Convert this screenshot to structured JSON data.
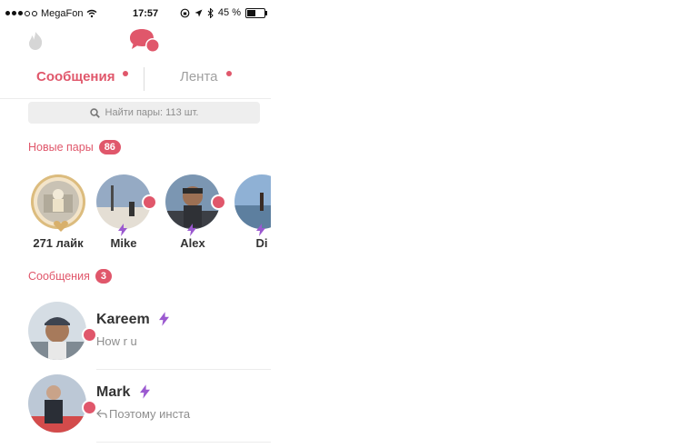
{
  "status_bar": {
    "carrier": "MegaFon",
    "time": "17:57",
    "battery": "45 %"
  },
  "tabs": {
    "messages": "Сообщения",
    "feed": "Лента"
  },
  "search": {
    "placeholder": "Найти пары: 113 шт."
  },
  "new_pairs": {
    "title": "Новые пары",
    "count": "86",
    "items": [
      {
        "label": "271 лайк"
      },
      {
        "label": "Mike"
      },
      {
        "label": "Alex"
      },
      {
        "label": "Di"
      }
    ]
  },
  "messages": {
    "title": "Сообщения",
    "count": "3",
    "items": [
      {
        "name": "Kareem",
        "preview": "How r u"
      },
      {
        "name": "Mark",
        "preview": "Поэтому инста"
      }
    ]
  },
  "colors": {
    "accent": "#e0576b",
    "bolt": "#9b59d0",
    "muted": "#8e8e8e"
  }
}
